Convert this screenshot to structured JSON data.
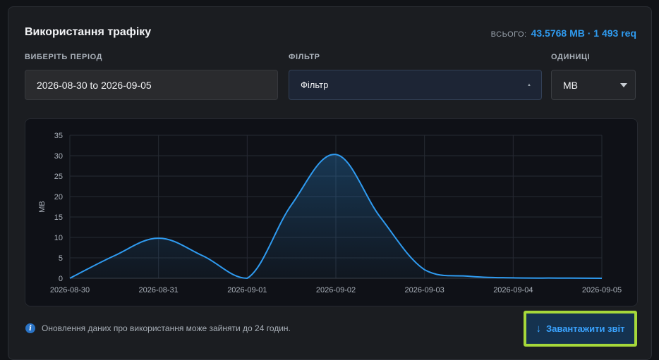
{
  "header": {
    "title": "Використання трафіку",
    "total_label": "ВСЬОГО:",
    "total_value": "43.5768 MB · 1 493 req"
  },
  "filters": {
    "period_label": "ВИБЕРІТЬ ПЕРІОД",
    "period_value": "2026-08-30 to 2026-09-05",
    "filter_label": "ФІЛЬТР",
    "filter_value": "Фільтр",
    "units_label": "ОДИНИЦІ",
    "units_value": "MB"
  },
  "footer": {
    "note": "Оновлення даних про використання може зайняти до 24 годин.",
    "download_label": "Завантажити звіт",
    "download_icon": "download-arrow-icon"
  },
  "colors": {
    "accent": "#2f9bf0",
    "highlight_border": "#a6d83a"
  },
  "chart_data": {
    "type": "area",
    "x": [
      "2026-08-30",
      "2026-08-30 12:00",
      "2026-08-31",
      "2026-08-31 12:00",
      "2026-09-01",
      "2026-09-01 12:00",
      "2026-09-02",
      "2026-09-02 12:00",
      "2026-09-03",
      "2026-09-03 12:00",
      "2026-09-04",
      "2026-09-04 12:00",
      "2026-09-05"
    ],
    "categories": [
      "2026-08-30",
      "2026-08-31",
      "2026-09-01",
      "2026-09-02",
      "2026-09-03",
      "2026-09-04",
      "2026-09-05"
    ],
    "values": [
      0,
      5.5,
      9.8,
      5.5,
      0,
      18,
      30.3,
      15,
      2.1,
      0.5,
      0.1,
      0.05,
      0
    ],
    "ylabel": "MB",
    "xlabel": "",
    "ylim": [
      0,
      35
    ],
    "yticks": [
      0,
      5,
      10,
      15,
      20,
      25,
      30,
      35
    ],
    "grid": true,
    "series_color": "#2f9bf0"
  }
}
